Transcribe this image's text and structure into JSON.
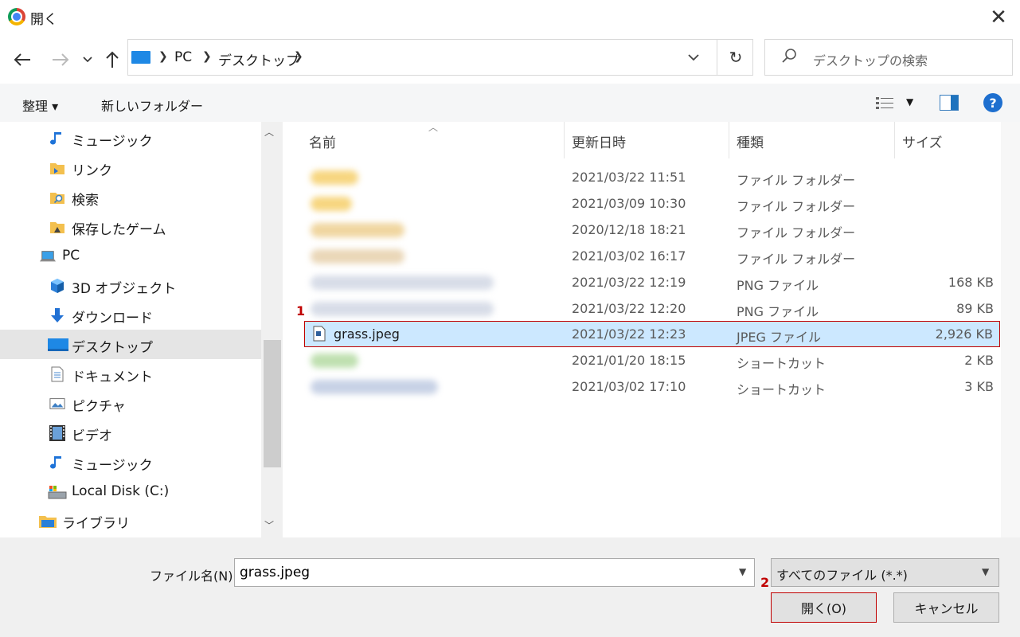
{
  "window": {
    "title": "開く"
  },
  "address": {
    "crumbs": [
      "PC",
      "デスクトップ"
    ]
  },
  "search": {
    "placeholder": "デスクトップの検索"
  },
  "toolbar": {
    "organize": "整理 ▾",
    "new_folder": "新しいフォルダー"
  },
  "sidebar": {
    "items": [
      {
        "label": "ミュージック",
        "icon": "music-note-icon"
      },
      {
        "label": "リンク",
        "icon": "links-folder-icon"
      },
      {
        "label": "検索",
        "icon": "searches-folder-icon"
      },
      {
        "label": "保存したゲーム",
        "icon": "saved-games-folder-icon"
      },
      {
        "label": "PC",
        "icon": "pc-icon"
      },
      {
        "label": "3D オブジェクト",
        "icon": "3d-objects-icon"
      },
      {
        "label": "ダウンロード",
        "icon": "download-arrow-icon"
      },
      {
        "label": "デスクトップ",
        "icon": "desktop-icon"
      },
      {
        "label": "ドキュメント",
        "icon": "document-icon"
      },
      {
        "label": "ピクチャ",
        "icon": "pictures-icon"
      },
      {
        "label": "ビデオ",
        "icon": "video-icon"
      },
      {
        "label": "ミュージック",
        "icon": "music-note-icon"
      },
      {
        "label": "Local Disk (C:)",
        "icon": "local-disk-icon"
      },
      {
        "label": "ライブラリ",
        "icon": "libraries-icon"
      }
    ]
  },
  "filelist": {
    "headers": {
      "name": "名前",
      "date": "更新日時",
      "type": "種類",
      "size": "サイズ"
    },
    "rows": [
      {
        "name": "",
        "date": "2021/03/22 11:51",
        "type": "ファイル フォルダー",
        "size": ""
      },
      {
        "name": "",
        "date": "2021/03/09 10:30",
        "type": "ファイル フォルダー",
        "size": ""
      },
      {
        "name": "",
        "date": "2020/12/18 18:21",
        "type": "ファイル フォルダー",
        "size": ""
      },
      {
        "name": "",
        "date": "2021/03/02 16:17",
        "type": "ファイル フォルダー",
        "size": ""
      },
      {
        "name": "",
        "date": "2021/03/22 12:19",
        "type": "PNG ファイル",
        "size": "168 KB"
      },
      {
        "name": "",
        "date": "2021/03/22 12:20",
        "type": "PNG ファイル",
        "size": "89 KB"
      },
      {
        "name": "grass.jpeg",
        "date": "2021/03/22 12:23",
        "type": "JPEG ファイル",
        "size": "2,926 KB"
      },
      {
        "name": "",
        "date": "2021/01/20 18:15",
        "type": "ショートカット",
        "size": "2 KB"
      },
      {
        "name": "",
        "date": "2021/03/02 17:10",
        "type": "ショートカット",
        "size": "3 KB"
      }
    ]
  },
  "annotations": {
    "step1": "1",
    "step2": "2"
  },
  "bottom": {
    "filename_label": "ファイル名(N):",
    "filename_value": "grass.jpeg",
    "filter_value": "すべてのファイル (*.*)",
    "open_label": "開く(O)",
    "cancel_label": "キャンセル"
  },
  "colors": {
    "selection": "#cce8ff",
    "annotation": "#c00000",
    "accent": "#1e88e5"
  }
}
